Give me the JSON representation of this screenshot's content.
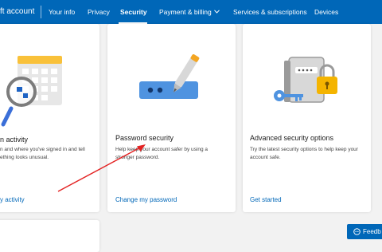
{
  "nav": {
    "brand": "ft account",
    "items": [
      "Your info",
      "Privacy",
      "Security",
      "Payment & billing",
      "Services & subscriptions",
      "Devices"
    ],
    "active": "Security"
  },
  "cards": {
    "activity": {
      "title": "n activity",
      "desc": "n and where you've signed in and tell\nething looks unusual.",
      "link": "y activity"
    },
    "password": {
      "title": "Password security",
      "desc": "Help keep your account safer by using a\nstronger password.",
      "link": "Change my password"
    },
    "advanced": {
      "title": "Advanced security options",
      "desc": "Try the latest security options to help keep your\naccount safe.",
      "link": "Get started"
    }
  },
  "feedback": {
    "label": "Feedb"
  },
  "icons": {
    "activity": "calendar-magnifier-icon",
    "password": "password-field-pen-icon",
    "advanced": "key-padlock-icon",
    "feedback": "feedback-icon"
  },
  "colors": {
    "accent": "#0067b8",
    "annotation": "#e32222"
  }
}
